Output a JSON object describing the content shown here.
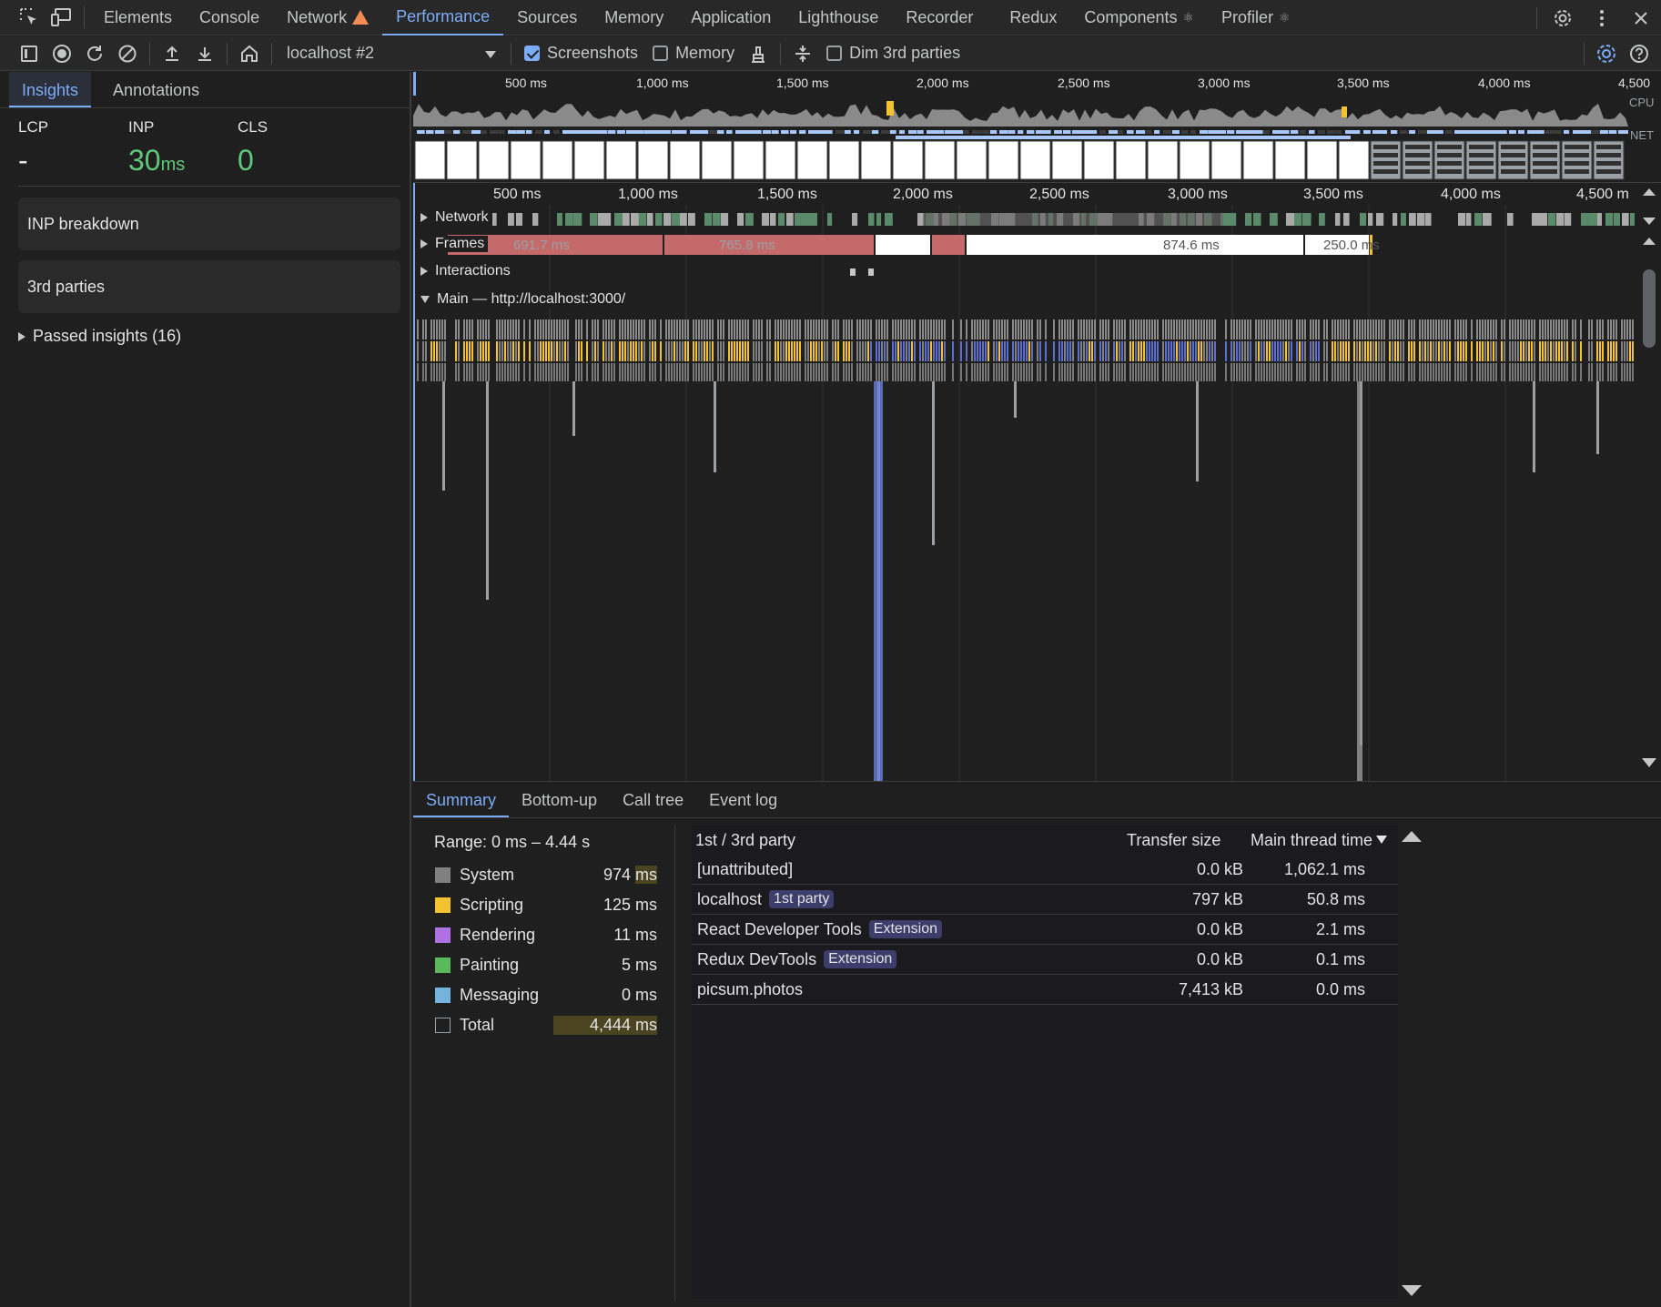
{
  "topbar": {
    "tabs": [
      "Elements",
      "Console",
      "Network",
      "Performance",
      "Sources",
      "Memory",
      "Application",
      "Lighthouse",
      "Recorder",
      "Redux",
      "Components",
      "Profiler"
    ],
    "active_tab": "Performance"
  },
  "toolbar": {
    "target": "localhost #2",
    "screenshots_label": "Screenshots",
    "screenshots_checked": true,
    "memory_label": "Memory",
    "memory_checked": false,
    "dim_label": "Dim 3rd parties",
    "dim_checked": false
  },
  "sidebar": {
    "tabs": [
      "Insights",
      "Annotations"
    ],
    "metrics": {
      "lcp_label": "LCP",
      "lcp_value": "-",
      "inp_label": "INP",
      "inp_value": "30",
      "inp_unit": "ms",
      "cls_label": "CLS",
      "cls_value": "0"
    },
    "cards": [
      "INP breakdown",
      "3rd parties"
    ],
    "passed": "Passed insights (16)"
  },
  "overview": {
    "ruler": [
      "500 ms",
      "1,000 ms",
      "1,500 ms",
      "2,000 ms",
      "2,500 ms",
      "3,000 ms",
      "3,500 ms",
      "4,000 ms",
      "4,500"
    ],
    "cpu_label": "CPU",
    "net_label": "NET"
  },
  "timeline": {
    "ruler": [
      "500 ms",
      "1,000 ms",
      "1,500 ms",
      "2,000 ms",
      "2,500 ms",
      "3,000 ms",
      "3,500 ms",
      "4,000 ms",
      "4,500 m"
    ],
    "tracks": {
      "network": "Network",
      "frames": "Frames",
      "interactions": "Interactions",
      "main": "Main — http://localhost:3000/"
    },
    "frame_labels": [
      "691.7 ms",
      "765.8 ms",
      "874.6 ms",
      "250.0 ms"
    ]
  },
  "bottom": {
    "tabs": [
      "Summary",
      "Bottom-up",
      "Call tree",
      "Event log"
    ],
    "range": "Range: 0 ms – 4.44 s",
    "summary": [
      {
        "label": "System",
        "value": "974",
        "unit": "ms",
        "color": "#808080"
      },
      {
        "label": "Scripting",
        "value": "125",
        "unit": "ms",
        "color": "#f2c231"
      },
      {
        "label": "Rendering",
        "value": "11",
        "unit": "ms",
        "color": "#af70e3"
      },
      {
        "label": "Painting",
        "value": "5",
        "unit": "ms",
        "color": "#5ab95a"
      },
      {
        "label": "Messaging",
        "value": "0",
        "unit": "ms",
        "color": "#73b3dd"
      },
      {
        "label": "Total",
        "value": "4,444",
        "unit": "ms",
        "color": ""
      }
    ],
    "table": {
      "headers": [
        "1st / 3rd party",
        "Transfer size",
        "Main thread time"
      ],
      "rows": [
        {
          "name": "[unattributed]",
          "badge": "",
          "size": "0.0 kB",
          "time": "1,062.1 ms"
        },
        {
          "name": "localhost",
          "badge": "1st party",
          "size": "797 kB",
          "time": "50.8 ms"
        },
        {
          "name": "React Developer Tools",
          "badge": "Extension",
          "size": "0.0 kB",
          "time": "2.1 ms"
        },
        {
          "name": "Redux DevTools",
          "badge": "Extension",
          "size": "0.0 kB",
          "time": "0.1 ms"
        },
        {
          "name": "picsum.photos",
          "badge": "",
          "size": "7,413 kB",
          "time": "0.0 ms"
        }
      ]
    }
  }
}
